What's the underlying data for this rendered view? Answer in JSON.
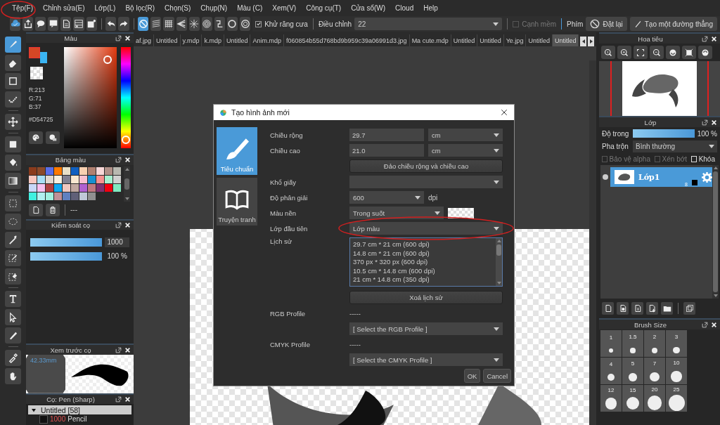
{
  "menu": [
    "Tệp(F)",
    "Chỉnh sửa(E)",
    "Lớp(L)",
    "Bộ lọc(R)",
    "Chọn(S)",
    "Chụp(N)",
    "Màu (C)",
    "Xem(V)",
    "Công cụ(T)",
    "Cửa sổ(W)",
    "Cloud",
    "Help"
  ],
  "toolbar": {
    "guides": [
      {
        "selected": true
      },
      {
        "selected": false
      },
      {
        "selected": false
      },
      {
        "selected": false
      },
      {
        "selected": false
      },
      {
        "selected": false
      },
      {
        "selected": false
      },
      {
        "selected": false
      },
      {
        "selected": false
      }
    ],
    "antialias": {
      "label": "Khử răng cưa",
      "checked": true
    },
    "adjust": {
      "label": "Điều chỉnh",
      "value": "22"
    },
    "soft_edge": {
      "label": "Cạnh mềm",
      "checked": false
    },
    "key_label": "Phím",
    "reset_button": "Đặt lại",
    "line_button": "Tạo một đường thẳng"
  },
  "tools": [
    {
      "selected": true
    },
    {
      "selected": false
    },
    {
      "selected": false
    },
    {
      "selected": false
    },
    {
      "selected": false
    },
    {
      "selected": false
    },
    {
      "selected": false
    },
    {
      "selected": false
    },
    {
      "selected": false
    },
    {
      "selected": false
    },
    {
      "selected": false
    },
    {
      "selected": false
    },
    {
      "selected": false
    },
    {
      "selected": false
    },
    {
      "selected": false
    },
    {
      "selected": false
    },
    {
      "selected": false
    },
    {
      "selected": false
    }
  ],
  "color_panel": {
    "title": "Màu",
    "color": "#d54725",
    "r": "R:213",
    "g": "G:71",
    "b": "B:37",
    "hex": "#D54725"
  },
  "palette_panel": {
    "title": "Bảng màu",
    "name": "---",
    "swatches": [
      {
        "color": "#8a3b1c"
      },
      {
        "color": "#8b4a2a"
      },
      {
        "color": "#5a6ee8"
      },
      {
        "color": "#ff7a00"
      },
      {
        "color": "#e8e0c8"
      },
      {
        "color": "#1060c0"
      },
      {
        "color": "#f8d0b0"
      },
      {
        "color": "#b08070"
      },
      {
        "color": "#f8d8d8"
      },
      {
        "color": "#b09088"
      },
      {
        "color": "#b8b8b0"
      },
      {
        "color": "#f8c8c0"
      },
      {
        "color": "#a8e0f8"
      },
      {
        "color": "#e0d8d0"
      },
      {
        "color": "#f8f0e0"
      },
      {
        "color": "#808090"
      },
      {
        "color": "#f8e8d0"
      },
      {
        "color": "#f8c0d0"
      },
      {
        "color": "#1890d0"
      },
      {
        "color": "#f89090"
      },
      {
        "color": "#a8f0d0"
      },
      {
        "color": "#d0d0d0"
      },
      {
        "color": "#c8d8f8"
      },
      {
        "color": "#f8c0f0"
      },
      {
        "color": "#b04040"
      },
      {
        "color": "#10a8f0"
      },
      {
        "color": "#f0c8c0"
      },
      {
        "color": "#c0a8a0"
      },
      {
        "color": "#b060d0"
      },
      {
        "color": "#c07880"
      },
      {
        "color": "#803070"
      },
      {
        "color": "#f00010"
      },
      {
        "color": "#80e8c0"
      },
      {
        "color": "#40f0e0"
      },
      {
        "color": "#b0f0f0"
      },
      {
        "color": "#a0f0e0"
      },
      {
        "color": "#c09098"
      },
      {
        "color": "#6080c0"
      },
      {
        "color": "#606078"
      },
      {
        "color": "#c0c8d8"
      },
      {
        "color": "#909090"
      }
    ]
  },
  "brush_control": {
    "title": "Kiểm soát cọ",
    "sliders": [
      {
        "level": 1,
        "reading": "1000"
      },
      {
        "level": 1,
        "reading": "100 %"
      }
    ]
  },
  "brush_preview": {
    "title": "Xem trước cọ",
    "size": "42.33mm"
  },
  "brush_list": {
    "title": "Cọ: Pen (Sharp)",
    "groups": [
      {
        "label": "Untitled [58]",
        "expanded": true,
        "children": [
          {
            "size": "1000",
            "name": "Pencil"
          }
        ]
      }
    ]
  },
  "tabs": [
    {
      "label": "af.jpg",
      "selected": false
    },
    {
      "label": "Untitled",
      "selected": false
    },
    {
      "label": "y.mdp",
      "selected": false
    },
    {
      "label": "k.mdp",
      "selected": false
    },
    {
      "label": "Untitled",
      "selected": false
    },
    {
      "label": "Anim.mdp",
      "selected": false
    },
    {
      "label": "f060854b55d768bd9b959c39a06991d3.jpg",
      "selected": false
    },
    {
      "label": "Ma cute.mdp",
      "selected": false
    },
    {
      "label": "Untitled",
      "selected": false
    },
    {
      "label": "Untitled",
      "selected": false
    },
    {
      "label": "Ye.jpg",
      "selected": false
    },
    {
      "label": "Untitled",
      "selected": false
    },
    {
      "label": "Untitled",
      "selected": true
    }
  ],
  "dialog": {
    "title": "Tạo hình ảnh mới",
    "modes": [
      {
        "label": "Tiêu chuẩn",
        "selected": true
      },
      {
        "label": "Truyện tranh",
        "selected": false
      }
    ],
    "width": {
      "label": "Chiều rộng",
      "value": "29.7",
      "unit": "cm"
    },
    "height": {
      "label": "Chiều cao",
      "value": "21.0",
      "unit": "cm"
    },
    "swap_button": "Đảo chiều rộng và chiều cao",
    "paper": {
      "label": "Khổ giấy"
    },
    "resolution": {
      "label": "Độ phân giải",
      "value": "600",
      "unit": "dpi"
    },
    "background": {
      "label": "Màu nền",
      "value": "Trong suốt"
    },
    "first_layer": {
      "label": "Lớp đầu tiên",
      "value": "Lớp màu"
    },
    "history": {
      "label": "Lịch sử",
      "items": [
        "29.7 cm * 21 cm (600 dpi)",
        "14.8 cm * 21 cm (600 dpi)",
        "370 px * 320 px (600 dpi)",
        "10.5 cm * 14.8 cm (600 dpi)",
        "21 cm * 14.8 cm (350 dpi)"
      ]
    },
    "clear_history_button": "Xoá lịch sử",
    "rgb": {
      "label": "RGB Profile",
      "value": "-----",
      "select": "[ Select the RGB Profile ]"
    },
    "cmyk": {
      "label": "CMYK Profile",
      "value": "-----",
      "select": "[ Select the CMYK Profile ]"
    },
    "ok_button": "OK",
    "cancel_button": "Cancel"
  },
  "navigator": {
    "title": "Hoa tiêu"
  },
  "layers_panel": {
    "title": "Lớp",
    "opacity": {
      "label": "Độ trong",
      "level": 1,
      "reading": "100 %"
    },
    "blend": {
      "label": "Pha trộn",
      "value": "Bình thường"
    },
    "options": [
      {
        "label": "Bảo vệ alpha",
        "checked": false,
        "disabled": true
      },
      {
        "label": "Xén bớt",
        "checked": false,
        "disabled": true
      },
      {
        "label": "Khóa",
        "checked": false,
        "disabled": false
      }
    ],
    "layers": [
      {
        "name": "Lớp1",
        "selected": true,
        "badge": "8"
      }
    ]
  },
  "brush_size": {
    "title": "Brush Size",
    "sizes": [
      "1",
      "1.5",
      "2",
      "3",
      "4",
      "5",
      "7",
      "10",
      "12",
      "15",
      "20",
      "25"
    ]
  }
}
